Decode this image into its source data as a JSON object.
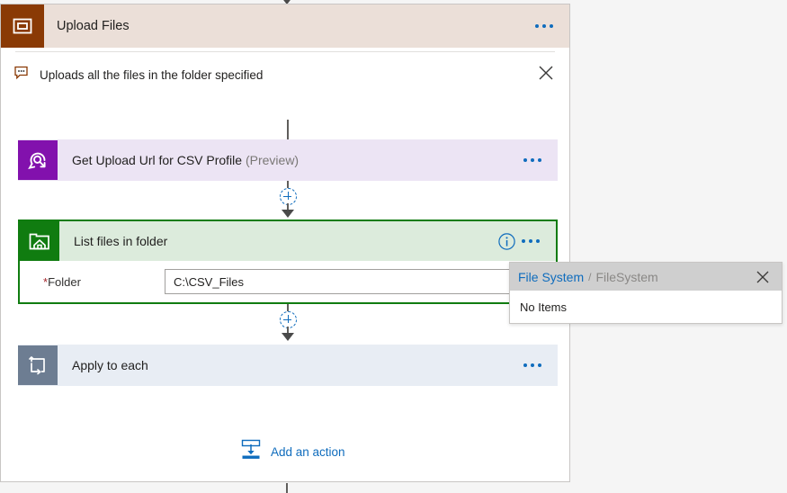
{
  "scope": {
    "title": "Upload Files",
    "icon": "scope-icon",
    "menu_icon": "ellipsis-icon",
    "comment": {
      "icon": "comment-icon",
      "text": "Uploads all the files in the folder specified",
      "close_icon": "close-icon"
    }
  },
  "actions": [
    {
      "id": "get-upload-url",
      "title": "Get Upload Url for CSV Profile",
      "suffix": "(Preview)",
      "icon": "connector-icon",
      "menu_icon": "ellipsis-icon"
    },
    {
      "id": "list-files-in-folder",
      "title": "List files in folder",
      "icon": "file-system-icon",
      "info_icon": "info-icon",
      "menu_icon": "ellipsis-icon",
      "fields": [
        {
          "required_marker": "*",
          "label": "Folder",
          "value": "C:\\CSV_Files",
          "placeholder": "Folder"
        }
      ]
    },
    {
      "id": "apply-to-each",
      "title": "Apply to each",
      "icon": "loop-icon",
      "menu_icon": "ellipsis-icon"
    }
  ],
  "connectors": {
    "plus_icon": "plus-icon",
    "arrow_icon": "arrow-down-icon"
  },
  "add_action": {
    "label": "Add an action",
    "icon": "insert-action-icon"
  },
  "flyout": {
    "title": "File System",
    "separator": "/",
    "subtitle": "FileSystem",
    "close_icon": "close-icon",
    "empty_text": "No Items"
  },
  "colors": {
    "scope_header_bg": "#ebdfd8",
    "scope_icon_bg": "#8a3a05",
    "connector_purple": "#8211ad",
    "connector_purple_bg": "#ece4f4",
    "filesystem_green": "#107c10",
    "filesystem_green_bg": "#dcebdc",
    "loop_slate": "#6d7d92",
    "loop_slate_bg": "#e8edf4",
    "accent_blue": "#0f6cbd",
    "required_red": "#a4262c"
  }
}
